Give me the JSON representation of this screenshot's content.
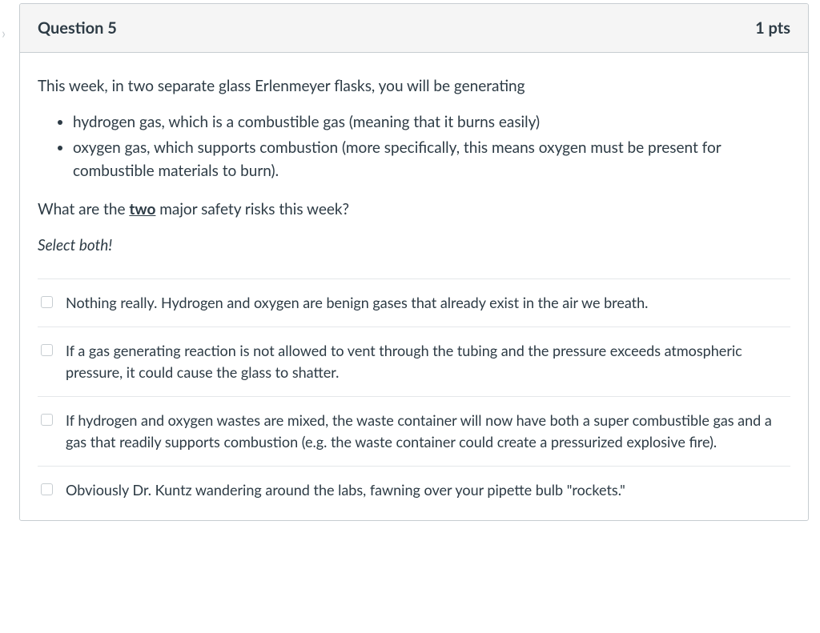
{
  "question": {
    "title": "Question 5",
    "points": "1 pts",
    "intro": "This week, in two separate glass Erlenmeyer flasks, you will be generating",
    "bullets": [
      "hydrogen gas, which is a combustible gas (meaning that it burns easily)",
      "oxygen gas, which supports combustion (more specifically, this means oxygen must be present for combustible materials to burn)."
    ],
    "prompt_prefix": "What are the ",
    "prompt_underlined": "two",
    "prompt_suffix": " major safety risks this week?",
    "select_hint": "Select both!",
    "answers": [
      "Nothing really. Hydrogen and oxygen are benign gases that already exist in the air we breath.",
      "If a gas generating reaction is not allowed to vent through the tubing and the pressure exceeds atmospheric pressure, it could cause the glass to shatter.",
      "If hydrogen and oxygen wastes are mixed, the waste container will now have both a super combustible gas and a gas that readily supports combustion (e.g. the waste container could create a pressurized explosive fire).",
      "Obviously Dr. Kuntz wandering around the labs, fawning over your pipette bulb \"rockets.\""
    ]
  }
}
